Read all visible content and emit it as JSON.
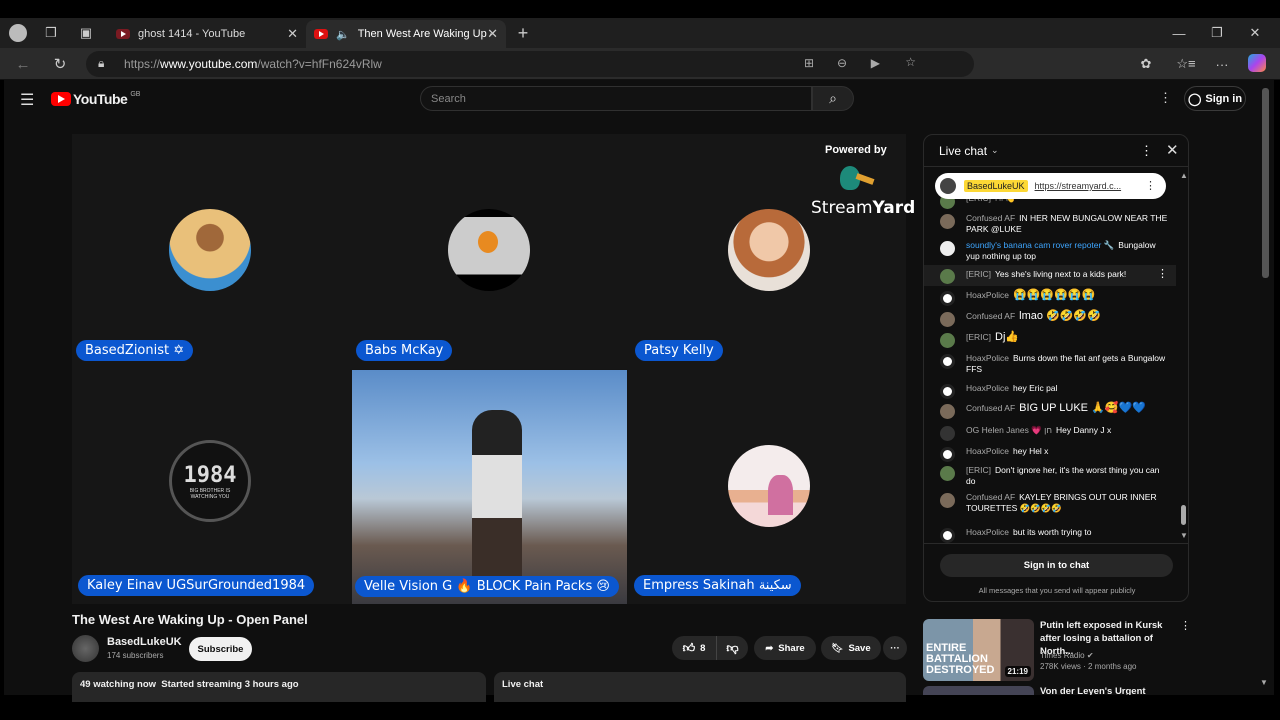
{
  "browser": {
    "tabs": [
      {
        "title": "ghost 1414 - YouTube",
        "active": false
      },
      {
        "title": "Then West Are Waking Up -",
        "active": true,
        "audio": true
      }
    ],
    "new_tab": "+",
    "url_scheme": "https://",
    "url_host": "www.youtube.com",
    "url_path": "/watch?v=hfFn624vRlw"
  },
  "youtube": {
    "logo": "YouTube",
    "region": "GB",
    "search_placeholder": "Search",
    "signin_label": "Sign in"
  },
  "stage": {
    "powered_by": "Powered by",
    "brand_light": "Stream",
    "brand_bold": "Yard",
    "participants": [
      {
        "name": "BasedZionist ✡"
      },
      {
        "name": "Babs McKay"
      },
      {
        "name": "Patsy Kelly"
      },
      {
        "name": "Kaley Einav UGSurGrounded1984"
      },
      {
        "name": "Velle Vision G 🔥 BLOCK Pain Packs 😢"
      },
      {
        "name": "Empress Sakinah سكينة"
      }
    ],
    "logo_1984": "1984",
    "logo_1984_sub": "BIG BROTHER IS WATCHING YOU"
  },
  "video": {
    "title": "The West Are Waking Up - Open Panel",
    "channel": "BasedLukeUK",
    "subscribers": "174 subscribers",
    "subscribe_label": "Subscribe",
    "likes": "8",
    "share_label": "Share",
    "save_label": "Save",
    "watching": "49 watching now",
    "started": "Started streaming 3 hours ago",
    "live_chat_label": "Live chat"
  },
  "chat": {
    "header": "Live chat",
    "pinned_author": "BasedLukeUK",
    "pinned_link": "https://streamyard.c...",
    "messages": [
      {
        "author": "[ERIC]",
        "text": "Hi 👋"
      },
      {
        "author": "Confused AF",
        "text": "IN HER NEW BUNGALOW NEAR THE PARK @LUKE"
      },
      {
        "author": "soundly's banana cam rover repoter 🔧",
        "text": "Bungalow yup nothing up top"
      },
      {
        "author": "[ERIC]",
        "text": "Yes she's living next to a kids park!"
      },
      {
        "author": "HoaxPolice",
        "text": "😭😭😭😭😭😭"
      },
      {
        "author": "Confused AF",
        "text": "lmao 🤣🤣🤣🤣"
      },
      {
        "author": "[ERIC]",
        "text": "Dj👍"
      },
      {
        "author": "HoaxPolice",
        "text": "Burns down the flat anf gets a Bungalow FFS"
      },
      {
        "author": "HoaxPolice",
        "text": "hey Eric pal"
      },
      {
        "author": "Confused AF",
        "text": "BIG UP LUKE 🙏🥰💙💙"
      },
      {
        "author": "OG Helen Janes 💗 חן",
        "text": "Hey Danny J x"
      },
      {
        "author": "HoaxPolice",
        "text": "hey Hel x"
      },
      {
        "author": "[ERIC]",
        "text": "Don't ignore her, it's the worst thing you can do"
      },
      {
        "author": "Confused AF",
        "text": "KAYLEY BRINGS OUT OUR INNER TOURETTES 🤣🤣🤣🤣"
      },
      {
        "author": "HoaxPolice",
        "text": "but its worth trying to"
      }
    ],
    "signin_chat": "Sign in to chat",
    "public_note": "All messages that you send will appear publicly"
  },
  "recommended": [
    {
      "title": "Putin left exposed in Kursk after losing a battalion of North...",
      "channel": "Times Radio",
      "views": "278K views",
      "age": "2 months ago",
      "duration": "21:19",
      "thumb_text": "ENTIRE BATTALION DESTROYED"
    },
    {
      "title": "Von der Leyen's Urgent Warning:"
    }
  ]
}
